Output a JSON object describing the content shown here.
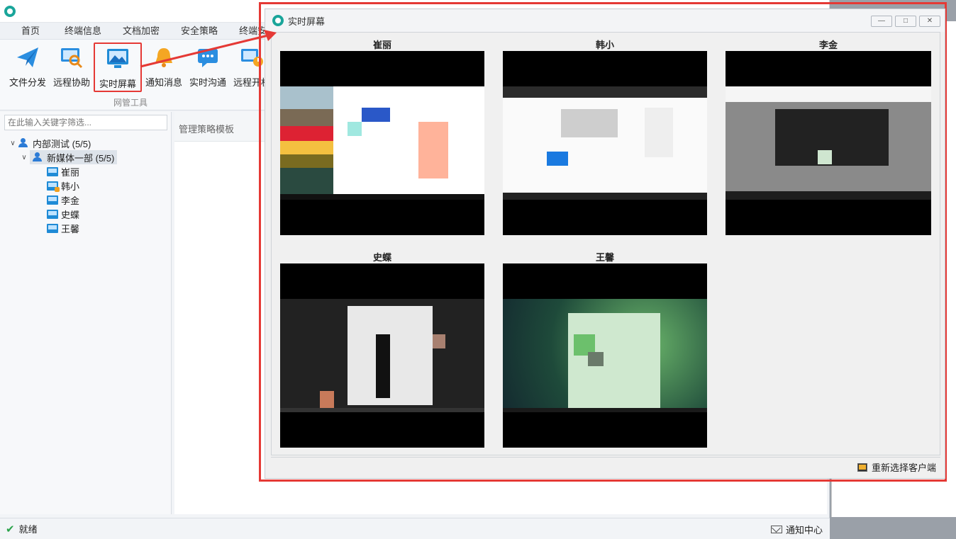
{
  "menu": [
    "首页",
    "终端信息",
    "文档加密",
    "安全策略",
    "终端安全"
  ],
  "tools": [
    {
      "label": "文件分发",
      "icon": "paper-plane-icon"
    },
    {
      "label": "远程协助",
      "icon": "magnifier-screen-icon"
    },
    {
      "label": "实时屏幕",
      "icon": "monitor-picture-icon"
    },
    {
      "label": "通知消息",
      "icon": "bell-icon"
    },
    {
      "label": "实时沟通",
      "icon": "chat-icon"
    },
    {
      "label": "远程开机",
      "icon": "power-on-icon"
    }
  ],
  "tool_group_label": "网管工具",
  "search": {
    "placeholder": "在此输入关键字筛选..."
  },
  "tree": {
    "root": "内部测试 (5/5)",
    "group": "新媒体一部 (5/5)",
    "clients": [
      "崔丽",
      "韩小",
      "李金",
      "史蝶",
      "王馨"
    ]
  },
  "main_tab": "管理策略模板",
  "status": {
    "text": "就绪",
    "notify": "通知中心"
  },
  "dialog": {
    "title": "实时屏幕",
    "screens": [
      "崔丽",
      "韩小",
      "李金",
      "史蝶",
      "王馨"
    ],
    "footer_button": "重新选择客户端"
  },
  "colors": {
    "highlight_border": "#e53935",
    "accent": "#1f8bd6"
  }
}
